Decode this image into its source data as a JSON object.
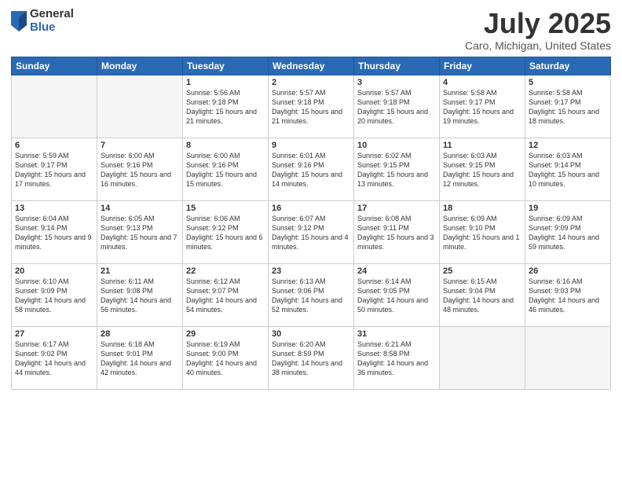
{
  "header": {
    "logo_general": "General",
    "logo_blue": "Blue",
    "title": "July 2025",
    "subtitle": "Caro, Michigan, United States"
  },
  "weekdays": [
    "Sunday",
    "Monday",
    "Tuesday",
    "Wednesday",
    "Thursday",
    "Friday",
    "Saturday"
  ],
  "weeks": [
    [
      {
        "day": "",
        "empty": true
      },
      {
        "day": "",
        "empty": true
      },
      {
        "day": "1",
        "sunrise": "5:56 AM",
        "sunset": "9:18 PM",
        "daylight": "15 hours and 21 minutes."
      },
      {
        "day": "2",
        "sunrise": "5:57 AM",
        "sunset": "9:18 PM",
        "daylight": "15 hours and 21 minutes."
      },
      {
        "day": "3",
        "sunrise": "5:57 AM",
        "sunset": "9:18 PM",
        "daylight": "15 hours and 20 minutes."
      },
      {
        "day": "4",
        "sunrise": "5:58 AM",
        "sunset": "9:17 PM",
        "daylight": "15 hours and 19 minutes."
      },
      {
        "day": "5",
        "sunrise": "5:58 AM",
        "sunset": "9:17 PM",
        "daylight": "15 hours and 18 minutes."
      }
    ],
    [
      {
        "day": "6",
        "sunrise": "5:59 AM",
        "sunset": "9:17 PM",
        "daylight": "15 hours and 17 minutes."
      },
      {
        "day": "7",
        "sunrise": "6:00 AM",
        "sunset": "9:16 PM",
        "daylight": "15 hours and 16 minutes."
      },
      {
        "day": "8",
        "sunrise": "6:00 AM",
        "sunset": "9:16 PM",
        "daylight": "15 hours and 15 minutes."
      },
      {
        "day": "9",
        "sunrise": "6:01 AM",
        "sunset": "9:16 PM",
        "daylight": "15 hours and 14 minutes."
      },
      {
        "day": "10",
        "sunrise": "6:02 AM",
        "sunset": "9:15 PM",
        "daylight": "15 hours and 13 minutes."
      },
      {
        "day": "11",
        "sunrise": "6:03 AM",
        "sunset": "9:15 PM",
        "daylight": "15 hours and 12 minutes."
      },
      {
        "day": "12",
        "sunrise": "6:03 AM",
        "sunset": "9:14 PM",
        "daylight": "15 hours and 10 minutes."
      }
    ],
    [
      {
        "day": "13",
        "sunrise": "6:04 AM",
        "sunset": "9:14 PM",
        "daylight": "15 hours and 9 minutes."
      },
      {
        "day": "14",
        "sunrise": "6:05 AM",
        "sunset": "9:13 PM",
        "daylight": "15 hours and 7 minutes."
      },
      {
        "day": "15",
        "sunrise": "6:06 AM",
        "sunset": "9:12 PM",
        "daylight": "15 hours and 6 minutes."
      },
      {
        "day": "16",
        "sunrise": "6:07 AM",
        "sunset": "9:12 PM",
        "daylight": "15 hours and 4 minutes."
      },
      {
        "day": "17",
        "sunrise": "6:08 AM",
        "sunset": "9:11 PM",
        "daylight": "15 hours and 3 minutes."
      },
      {
        "day": "18",
        "sunrise": "6:09 AM",
        "sunset": "9:10 PM",
        "daylight": "15 hours and 1 minute."
      },
      {
        "day": "19",
        "sunrise": "6:09 AM",
        "sunset": "9:09 PM",
        "daylight": "14 hours and 59 minutes."
      }
    ],
    [
      {
        "day": "20",
        "sunrise": "6:10 AM",
        "sunset": "9:09 PM",
        "daylight": "14 hours and 58 minutes."
      },
      {
        "day": "21",
        "sunrise": "6:11 AM",
        "sunset": "9:08 PM",
        "daylight": "14 hours and 56 minutes."
      },
      {
        "day": "22",
        "sunrise": "6:12 AM",
        "sunset": "9:07 PM",
        "daylight": "14 hours and 54 minutes."
      },
      {
        "day": "23",
        "sunrise": "6:13 AM",
        "sunset": "9:06 PM",
        "daylight": "14 hours and 52 minutes."
      },
      {
        "day": "24",
        "sunrise": "6:14 AM",
        "sunset": "9:05 PM",
        "daylight": "14 hours and 50 minutes."
      },
      {
        "day": "25",
        "sunrise": "6:15 AM",
        "sunset": "9:04 PM",
        "daylight": "14 hours and 48 minutes."
      },
      {
        "day": "26",
        "sunrise": "6:16 AM",
        "sunset": "9:03 PM",
        "daylight": "14 hours and 46 minutes."
      }
    ],
    [
      {
        "day": "27",
        "sunrise": "6:17 AM",
        "sunset": "9:02 PM",
        "daylight": "14 hours and 44 minutes."
      },
      {
        "day": "28",
        "sunrise": "6:18 AM",
        "sunset": "9:01 PM",
        "daylight": "14 hours and 42 minutes."
      },
      {
        "day": "29",
        "sunrise": "6:19 AM",
        "sunset": "9:00 PM",
        "daylight": "14 hours and 40 minutes."
      },
      {
        "day": "30",
        "sunrise": "6:20 AM",
        "sunset": "8:59 PM",
        "daylight": "14 hours and 38 minutes."
      },
      {
        "day": "31",
        "sunrise": "6:21 AM",
        "sunset": "8:58 PM",
        "daylight": "14 hours and 36 minutes."
      },
      {
        "day": "",
        "empty": true
      },
      {
        "day": "",
        "empty": true
      }
    ]
  ]
}
